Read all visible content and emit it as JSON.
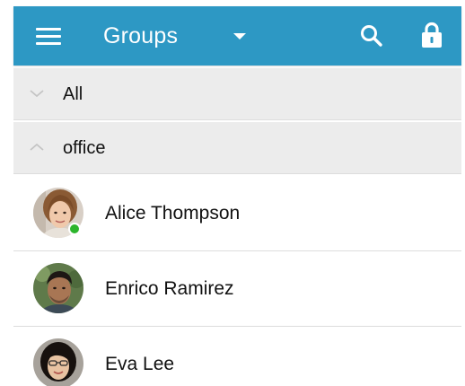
{
  "colors": {
    "accent": "#2d98c4",
    "online": "#2cb52c"
  },
  "appbar": {
    "title": "Groups",
    "icons": [
      "menu-icon",
      "dropdown-icon",
      "search-icon",
      "lock-icon"
    ]
  },
  "groups": [
    {
      "label": "All",
      "state": "collapsed",
      "icon": "chevron-down-icon"
    },
    {
      "label": "office",
      "state": "expanded",
      "icon": "chevron-up-icon"
    }
  ],
  "contacts": [
    {
      "name": "Alice Thompson",
      "status": "online"
    },
    {
      "name": "Enrico Ramirez",
      "status": ""
    },
    {
      "name": "Eva Lee",
      "status": ""
    }
  ]
}
